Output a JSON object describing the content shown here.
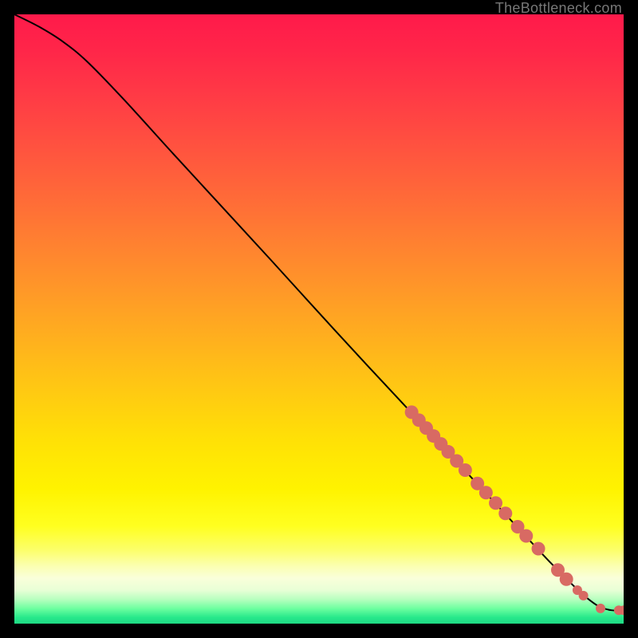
{
  "attribution": "TheBottleneck.com",
  "gradient_stops": [
    {
      "offset": 0.0,
      "color": "#ff1a4a"
    },
    {
      "offset": 0.06,
      "color": "#ff2649"
    },
    {
      "offset": 0.14,
      "color": "#ff3c45"
    },
    {
      "offset": 0.22,
      "color": "#ff533f"
    },
    {
      "offset": 0.3,
      "color": "#ff6a38"
    },
    {
      "offset": 0.38,
      "color": "#ff8230"
    },
    {
      "offset": 0.46,
      "color": "#ff9a27"
    },
    {
      "offset": 0.54,
      "color": "#ffb21d"
    },
    {
      "offset": 0.62,
      "color": "#ffca12"
    },
    {
      "offset": 0.7,
      "color": "#ffe106"
    },
    {
      "offset": 0.78,
      "color": "#fff300"
    },
    {
      "offset": 0.84,
      "color": "#ffff20"
    },
    {
      "offset": 0.88,
      "color": "#fcff6c"
    },
    {
      "offset": 0.905,
      "color": "#fbffb0"
    },
    {
      "offset": 0.925,
      "color": "#faffda"
    },
    {
      "offset": 0.945,
      "color": "#e8ffd6"
    },
    {
      "offset": 0.96,
      "color": "#b8ffbf"
    },
    {
      "offset": 0.975,
      "color": "#6effa0"
    },
    {
      "offset": 0.99,
      "color": "#26e88b"
    },
    {
      "offset": 1.0,
      "color": "#1fd983"
    }
  ],
  "chart_data": {
    "type": "line",
    "title": "",
    "xlabel": "",
    "ylabel": "",
    "xlim": [
      0,
      100
    ],
    "ylim": [
      0,
      100
    ],
    "series": [
      {
        "name": "curve",
        "x": [
          0,
          4,
          8,
          12,
          18,
          26,
          34,
          42,
          50,
          58,
          65,
          70,
          75,
          80,
          85,
          88,
          90,
          92,
          94,
          96,
          98,
          100
        ],
        "y": [
          100,
          98,
          95.5,
          92.2,
          86,
          77.2,
          68.5,
          59.8,
          51,
          42.3,
          34.8,
          29.4,
          24.0,
          18.6,
          13.2,
          10.0,
          8.0,
          6.0,
          4.2,
          2.8,
          2.2,
          2.2
        ]
      }
    ],
    "markers": {
      "name": "highlighted-points",
      "color": "#d86a63",
      "radius_big": 8.5,
      "radius_small": 6,
      "points": [
        {
          "x": 65.2,
          "y": 34.7,
          "r": 8.5
        },
        {
          "x": 66.4,
          "y": 33.4,
          "r": 8.5
        },
        {
          "x": 67.6,
          "y": 32.1,
          "r": 8.5
        },
        {
          "x": 68.8,
          "y": 30.8,
          "r": 8.5
        },
        {
          "x": 70.0,
          "y": 29.5,
          "r": 8.5
        },
        {
          "x": 71.2,
          "y": 28.2,
          "r": 8.5
        },
        {
          "x": 72.6,
          "y": 26.7,
          "r": 8.5
        },
        {
          "x": 74.0,
          "y": 25.2,
          "r": 8.5
        },
        {
          "x": 76.0,
          "y": 23.0,
          "r": 8.5
        },
        {
          "x": 77.4,
          "y": 21.5,
          "r": 8.5
        },
        {
          "x": 79.0,
          "y": 19.8,
          "r": 8.5
        },
        {
          "x": 80.6,
          "y": 18.1,
          "r": 8.5
        },
        {
          "x": 82.6,
          "y": 15.9,
          "r": 8.5
        },
        {
          "x": 84.0,
          "y": 14.4,
          "r": 8.5
        },
        {
          "x": 86.0,
          "y": 12.3,
          "r": 8.5
        },
        {
          "x": 89.2,
          "y": 8.8,
          "r": 8.5
        },
        {
          "x": 90.6,
          "y": 7.3,
          "r": 8.5
        },
        {
          "x": 92.4,
          "y": 5.5,
          "r": 6
        },
        {
          "x": 93.4,
          "y": 4.6,
          "r": 6
        },
        {
          "x": 96.2,
          "y": 2.5,
          "r": 6
        },
        {
          "x": 99.2,
          "y": 2.2,
          "r": 6
        },
        {
          "x": 100.0,
          "y": 2.2,
          "r": 6
        }
      ]
    }
  }
}
